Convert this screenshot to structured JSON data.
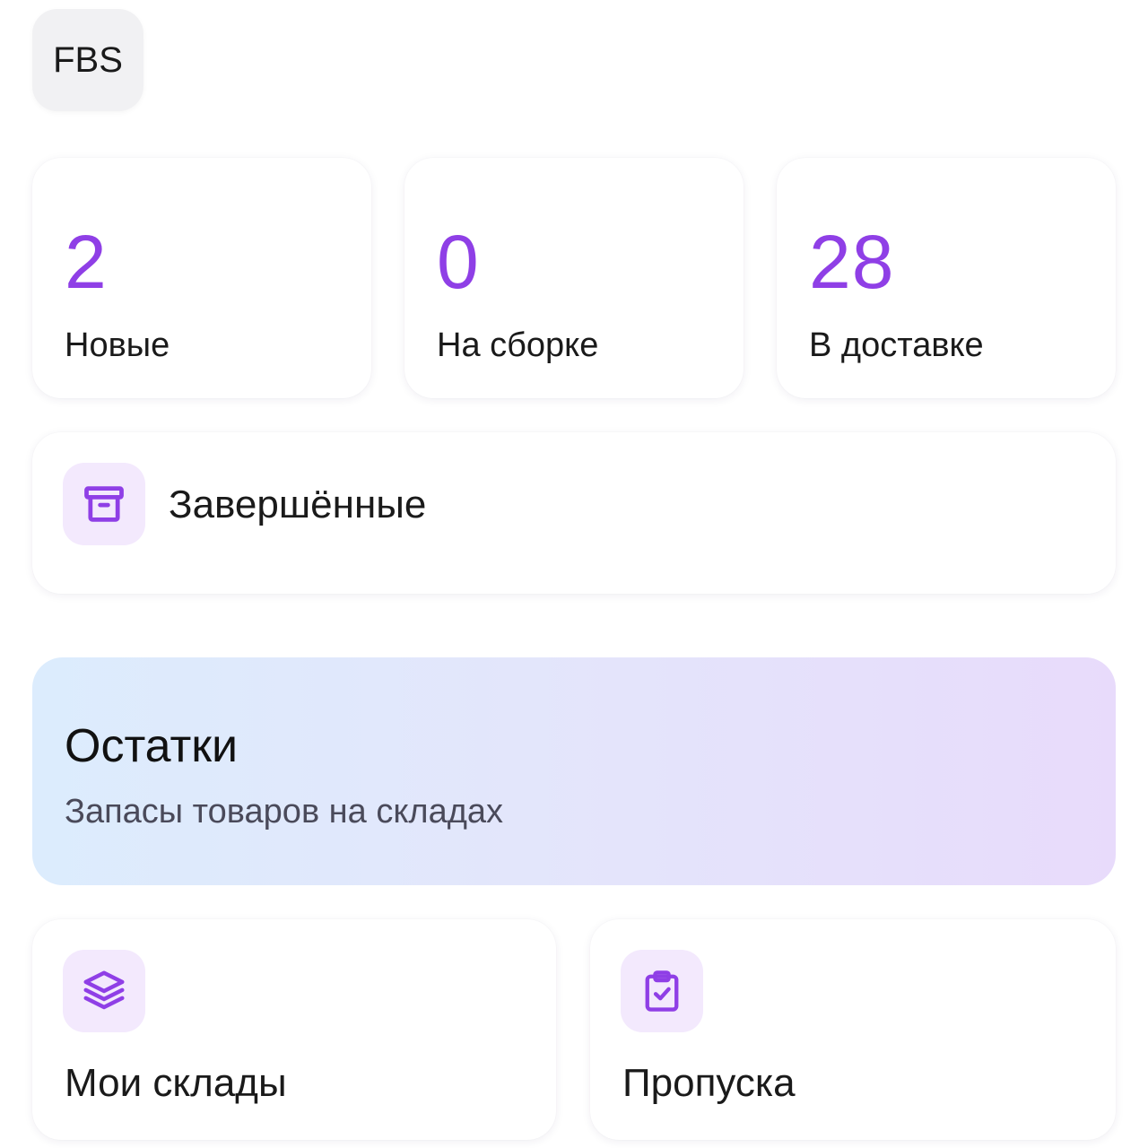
{
  "header": {
    "chip_label": "FBS"
  },
  "stats": [
    {
      "value": "2",
      "label": "Новые"
    },
    {
      "value": "0",
      "label": "На сборке"
    },
    {
      "value": "28",
      "label": "В доставке"
    }
  ],
  "completed": {
    "label": "Завершённые",
    "icon": "archive-box-icon"
  },
  "stock": {
    "title": "Остатки",
    "subtitle": "Запасы товаров на складах"
  },
  "tiles": [
    {
      "label": "Мои склады",
      "icon": "layers-stack-icon"
    },
    {
      "label": "Пропуска",
      "icon": "clipboard-check-icon"
    }
  ],
  "colors": {
    "accent": "#8f3fe6",
    "icon_bg": "#f3e9fd",
    "chip_bg": "#f1f1f3",
    "stock_gradient_start": "#dcecfd",
    "stock_gradient_end": "#e8dbfb"
  }
}
